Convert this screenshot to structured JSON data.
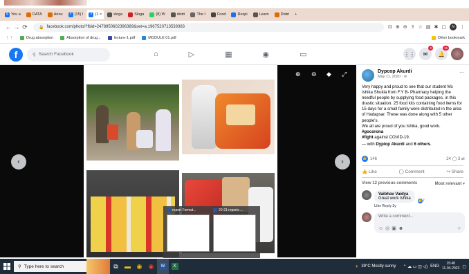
{
  "browser": {
    "tabs": [
      {
        "label": "You a",
        "color": "#1a73e8",
        "glyph": "S"
      },
      {
        "label": "DATA",
        "color": "#e06c00",
        "glyph": ""
      },
      {
        "label": "Annu",
        "color": "#e06c00",
        "glyph": ""
      },
      {
        "label": "(15) I",
        "color": "#1877f2",
        "glyph": "f"
      },
      {
        "label": "(1 ×",
        "color": "#1877f2",
        "glyph": "f",
        "active": true
      },
      {
        "label": "sloga",
        "color": "#555",
        "glyph": ""
      },
      {
        "label": "Sloga",
        "color": "#d21f1f",
        "glyph": ""
      },
      {
        "label": "(8) W",
        "color": "#25d366",
        "glyph": ""
      },
      {
        "label": "distri",
        "color": "#555",
        "glyph": ""
      },
      {
        "label": "The I",
        "color": "#666",
        "glyph": ""
      },
      {
        "label": "Food",
        "color": "#444",
        "glyph": ""
      },
      {
        "label": "Respi",
        "color": "#1a73e8",
        "glyph": ""
      },
      {
        "label": "Learn",
        "color": "#555",
        "glyph": ""
      },
      {
        "label": "Distri",
        "color": "#e06c00",
        "glyph": ""
      },
      {
        "label": "+",
        "color": "",
        "glyph": ""
      }
    ],
    "url": "facebook.com/photo/?fbid=2478950602396389&set=a.196752071353938​3",
    "profile_initial": "N",
    "bookmarks": [
      {
        "label": "Drug absorption",
        "color": "#4caf50"
      },
      {
        "label": "Absorption of drug...",
        "color": "#4caf50"
      },
      {
        "label": "lecture-1.pdf",
        "color": "#3949ab"
      },
      {
        "label": "MODULE 01.pdf",
        "color": "#1e88e5"
      }
    ],
    "other_bookmarks": "Other bookmark"
  },
  "facebook": {
    "search_placeholder": "Search Facebook",
    "messenger_badge": "2",
    "notif_badge": "15"
  },
  "post": {
    "author": "Dypcop Akurdi",
    "date": "May 11, 2020 · ⊚",
    "text": "Very happy and proud to see that our student Ms Ishika Shukla from F.Y B- Pharmacy helping the needful people by supplying food packages, in this drastic situation. 25 food kits containing food items for 15 days for a small family were distributed in the area of Hadapsar. These was done along with 5 other people's.",
    "text2": "We all are proud of you Ishika, good work.",
    "tag1": "#gocorona",
    "tag2": "#fight",
    "tag2_rest": " against COVID-19.",
    "with_prefix": "— with ",
    "with_person": "Dypiop Akurdi",
    "with_and": " and ",
    "with_others": "6 others",
    "with_end": ".",
    "like_count": "146",
    "comments_shares": "24 ◯  3 ⇄",
    "like": "Like",
    "comment": "Comment",
    "share": "Share",
    "view_prev": "View 12 previous comments",
    "most_relevant": "Most relevant ▾",
    "commenter": "Vaibhav Vaidya",
    "comment_text": "Great work Ishika",
    "comment_likes": "2",
    "comment_links": "Like   Reply   2y",
    "write_placeholder": "Write a comment..."
  },
  "previews": [
    {
      "label": "report Format..."
    },
    {
      "label": "20-21 reports ..."
    }
  ],
  "taskbar": {
    "search_placeholder": "Type here to search",
    "weather": "39°C  Mostly sunny",
    "lang": "ENG",
    "time": "15:48",
    "date": "11-04-2023"
  }
}
